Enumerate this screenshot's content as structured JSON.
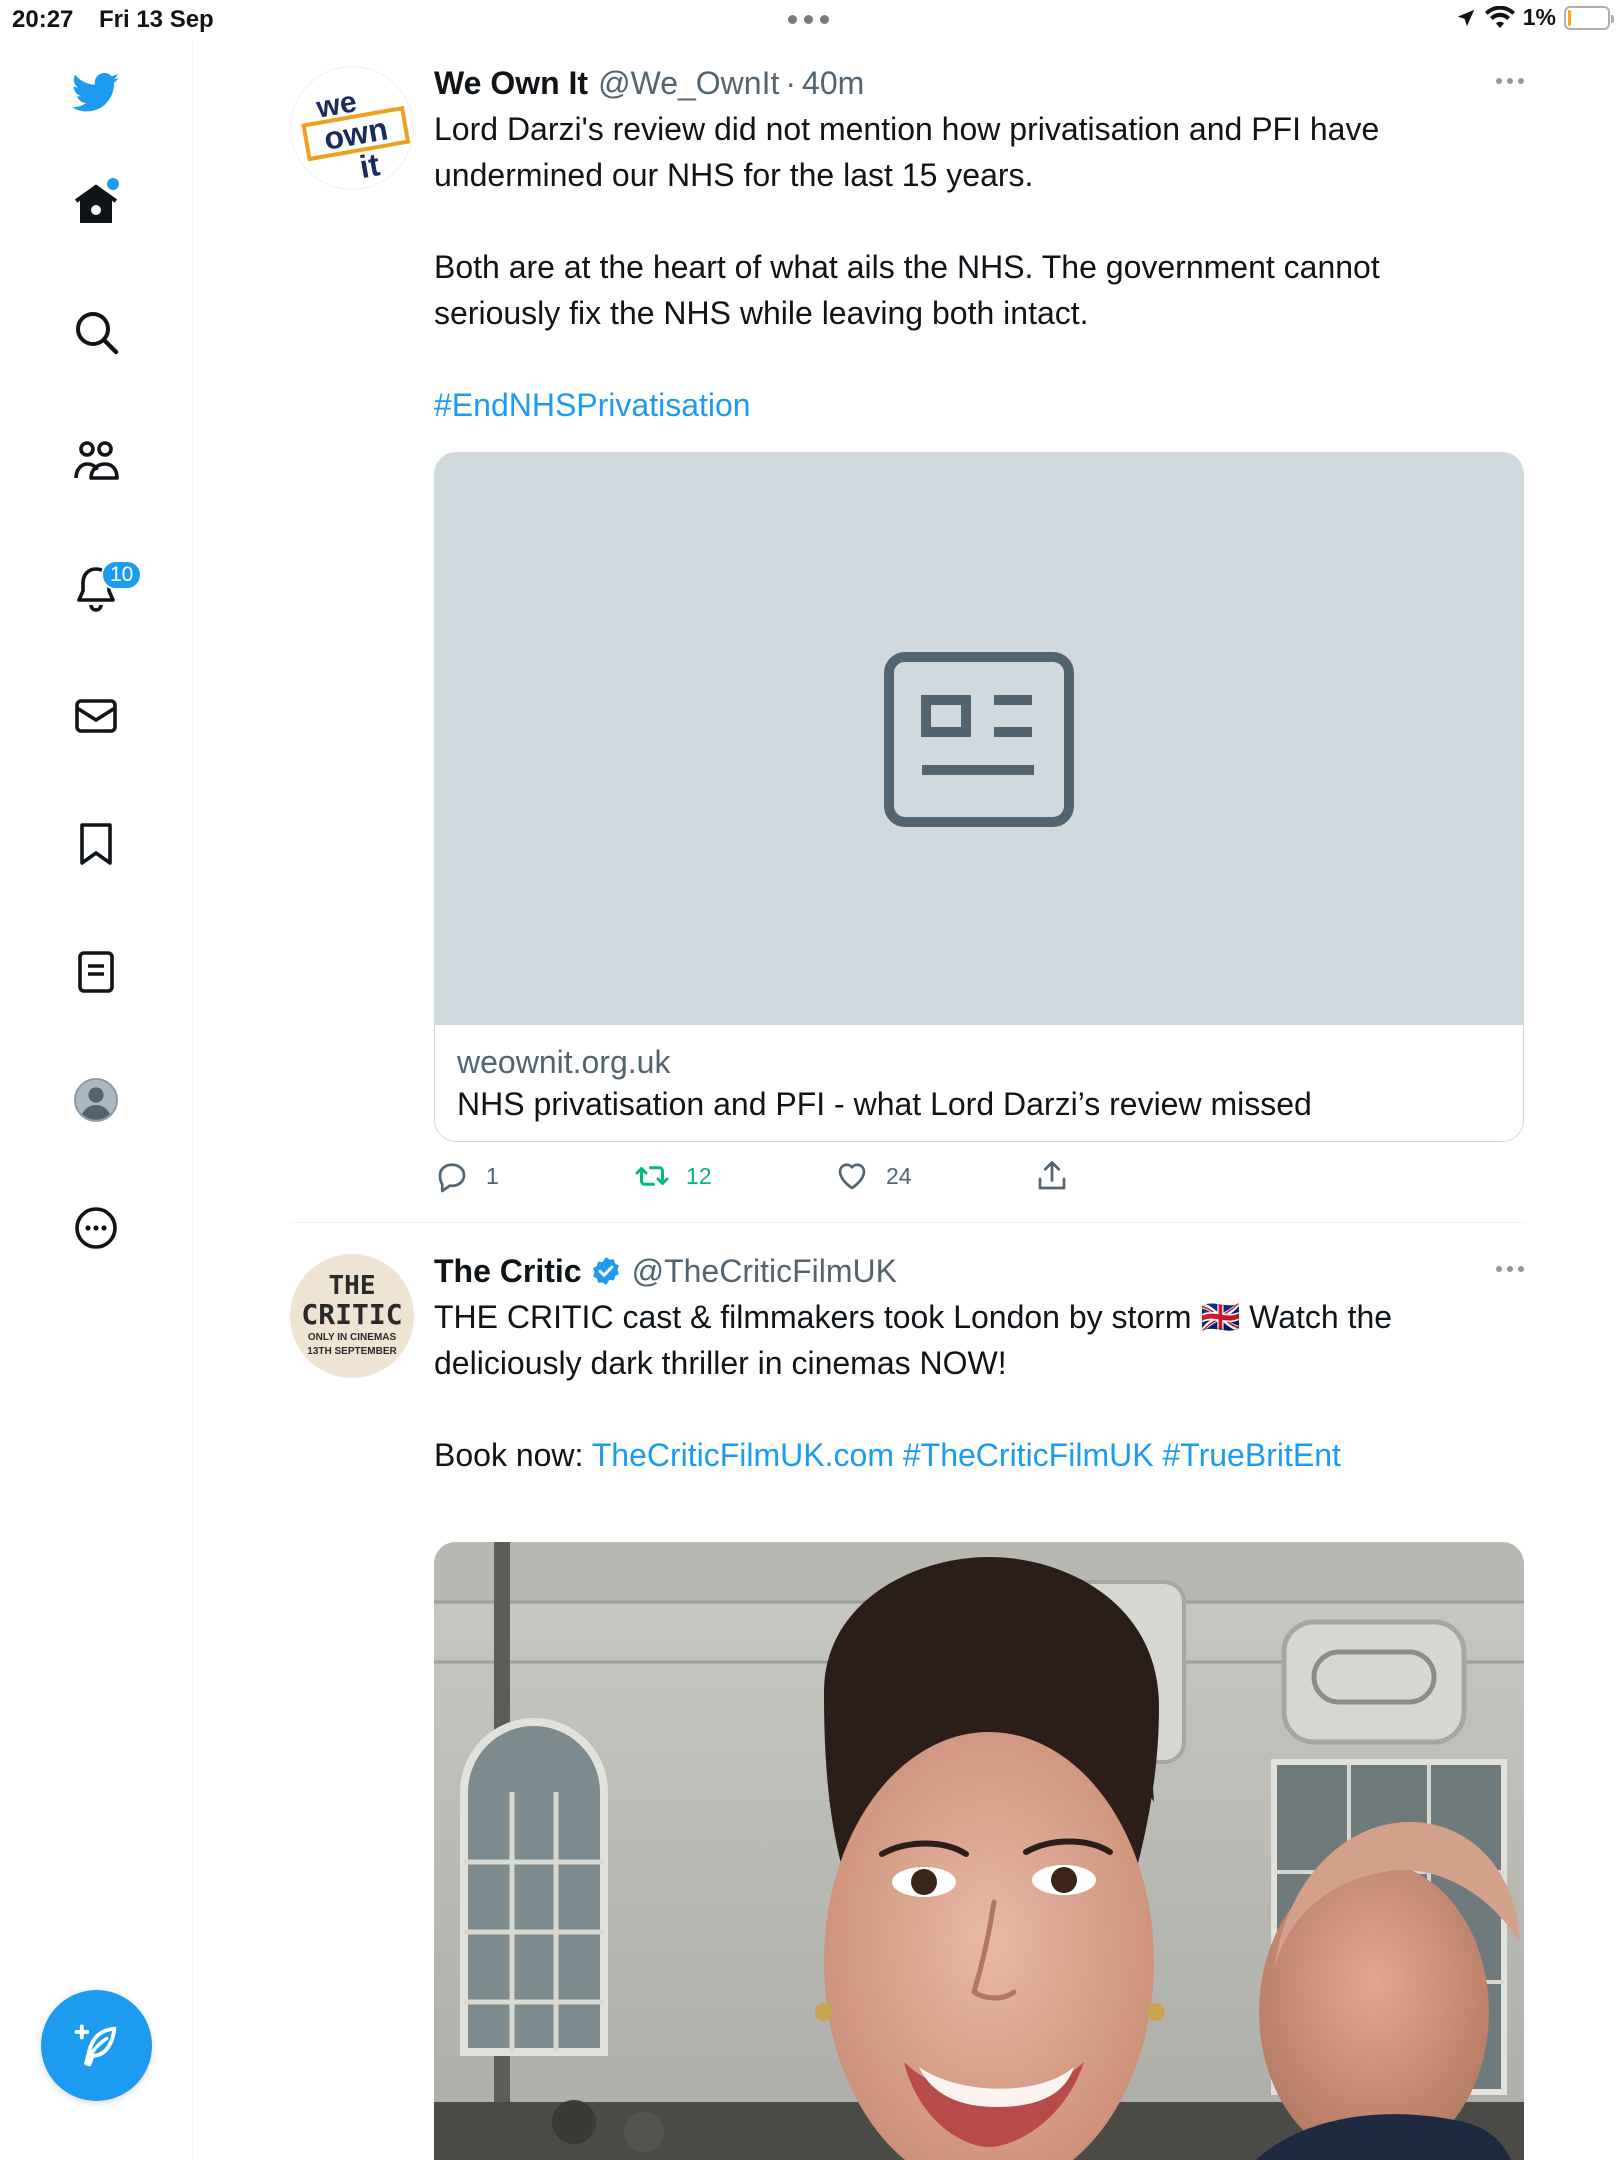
{
  "status_bar": {
    "time": "20:27",
    "date": "Fri 13 Sep",
    "battery": "1%"
  },
  "sidebar": {
    "notifications_badge": "10",
    "items": [
      "home",
      "search",
      "communities",
      "notifications",
      "messages",
      "bookmarks",
      "lists",
      "profile",
      "more"
    ]
  },
  "tweets": [
    {
      "name": "We Own It",
      "handle": "@We_OwnIt",
      "sep": "·",
      "time": "40m",
      "avatar_text": [
        "we",
        "own",
        "it"
      ],
      "text_lines": [
        "Lord Darzi's review did not mention how privatisation and PFI have",
        "undermined our NHS for the last 15 years.",
        "",
        "Both are at the heart of what ails the NHS. The government cannot",
        "seriously fix the NHS while leaving both intact.",
        ""
      ],
      "hashtag": "#EndNHSPrivatisation",
      "card": {
        "domain": "weownit.org.uk",
        "title": "NHS privatisation and PFI - what Lord Darzi’s review missed"
      },
      "stats": {
        "replies": "1",
        "retweets": "12",
        "likes": "24"
      }
    },
    {
      "name": "The Critic",
      "handle": "@TheCriticFilmUK",
      "avatar_text": [
        "THE",
        "CRITIC",
        "ONLY IN CINEMAS",
        "13TH SEPTEMBER"
      ],
      "text_line1": "THE CRITIC cast & filmmakers took London by storm 🇬🇧 Watch the",
      "text_line2": "deliciously dark thriller in cinemas NOW!",
      "book_label": "Book now:",
      "links": [
        "TheCriticFilmUK.com",
        "#TheCriticFilmUK",
        "#TrueBritEnt"
      ]
    }
  ],
  "colors": {
    "accent": "#1d9bf0",
    "retweet_green": "#00ba7c",
    "muted": "#536471"
  }
}
